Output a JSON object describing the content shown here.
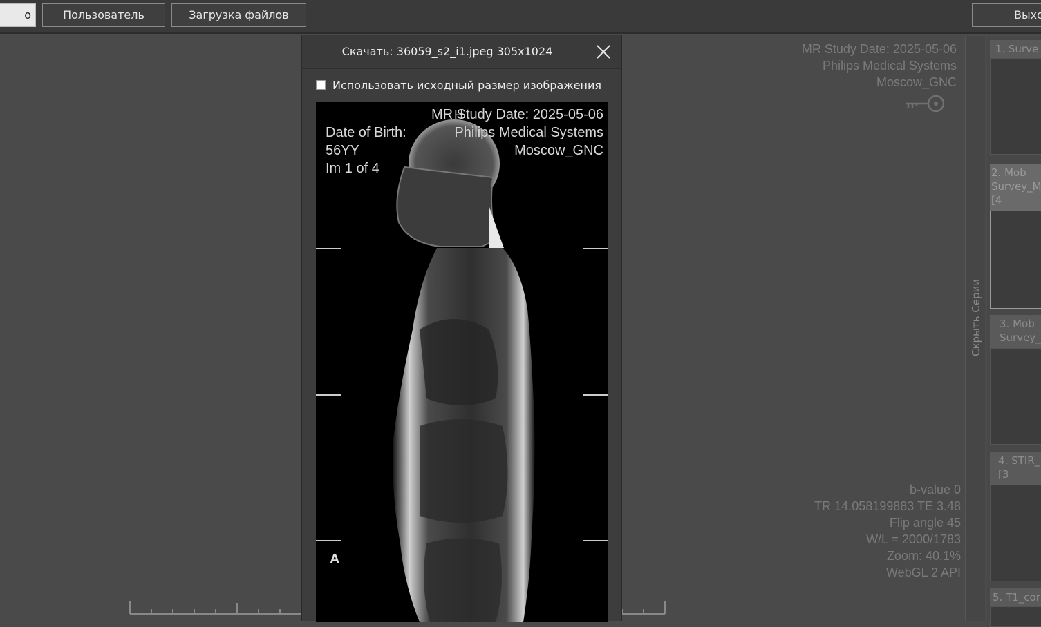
{
  "toolbar": {
    "active_tab_partial": "о",
    "user_button": "Пользователь",
    "upload_button": "Загрузка файлов",
    "exit_button_partial": "Выхо"
  },
  "viewer": {
    "overlay_top_right": [
      "MR Study Date: 2025-05-06",
      "Philips Medical Systems",
      "Moscow_GNC"
    ],
    "overlay_bottom_right": [
      "b-value 0",
      "TR 14.058199883 TE 3.48",
      "Flip angle 45",
      "W/L = 2000/1783",
      "Zoom: 40.1%",
      "WebGL 2 API"
    ],
    "key_icon": "key-icon"
  },
  "series_panel": {
    "hide_label": "Скрыть Серии",
    "items": [
      {
        "title": "1. Surve"
      },
      {
        "title": "2. Mob Survey_M [4"
      },
      {
        "title": "3. Mob Survey_"
      },
      {
        "title": "4. STIR_ [3"
      },
      {
        "title": "5. T1_cor"
      }
    ]
  },
  "modal": {
    "title": "Скачать: 36059_s2_i1.jpeg 305x1024",
    "checkbox_label": "Использовать исходный размер изображения",
    "checkbox_checked": false,
    "preview": {
      "top_right": [
        "MR Study Date: 2025-05-06",
        "Philips Medical Systems",
        "Moscow_GNC"
      ],
      "top_left": [
        "Date of Birth:",
        "56YY",
        "Im 1 of 4"
      ],
      "orientation_label": "A",
      "top_marker": "H"
    }
  },
  "colors": {
    "toolbar_bg": "#3a3a3a",
    "viewer_bg": "#4a4a4a",
    "modal_bg": "#3d3d3d",
    "overlay_text": "#7a7a7a"
  }
}
